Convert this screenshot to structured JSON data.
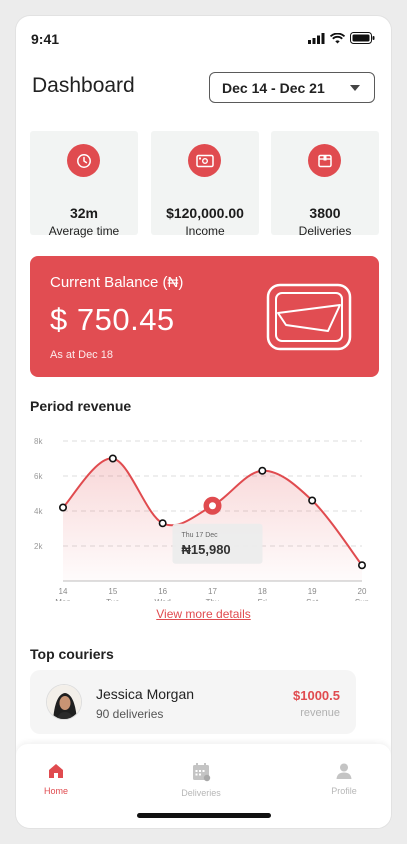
{
  "status_bar": {
    "time": "9:41"
  },
  "header": {
    "title": "Dashboard",
    "date_range": "Dec 14 - Dec 21"
  },
  "stats": [
    {
      "icon": "clock-icon",
      "value": "32m",
      "label": "Average time"
    },
    {
      "icon": "cash-icon",
      "value": "$120,000.00",
      "label": "Income"
    },
    {
      "icon": "package-icon",
      "value": "3800",
      "label": "Deliveries"
    }
  ],
  "balance": {
    "title": "Current Balance (₦)",
    "amount": "$ 750.45",
    "date": "As at Dec 18",
    "icon": "wallet-icon"
  },
  "period_revenue": {
    "title": "Period revenue",
    "link": "View more details"
  },
  "chart_data": {
    "type": "area",
    "title": "Period revenue",
    "y_ticks": [
      "8k",
      "6k",
      "4k",
      "2k"
    ],
    "ylim": [
      0,
      8000
    ],
    "categories": [
      {
        "day": "14",
        "weekday": "Mon"
      },
      {
        "day": "15",
        "weekday": "Tue"
      },
      {
        "day": "16",
        "weekday": "Wed"
      },
      {
        "day": "17",
        "weekday": "Thu"
      },
      {
        "day": "18",
        "weekday": "Fri"
      },
      {
        "day": "19",
        "weekday": "Sat"
      },
      {
        "day": "20",
        "weekday": "Sun"
      }
    ],
    "series": [
      {
        "x": [
          14,
          15,
          16,
          17,
          18,
          19,
          20
        ],
        "values": [
          4200,
          7000,
          3300,
          4300,
          6300,
          4600,
          900
        ]
      }
    ],
    "highlight": {
      "x": 17,
      "label": "Thu 17 Dec",
      "value": "₦15,980"
    },
    "grid": true,
    "accent": "#e04b4f"
  },
  "top_couriers": {
    "title": "Top couriers",
    "items": [
      {
        "name": "Jessica Morgan",
        "deliveries": "90 deliveries",
        "amount": "$1000.5",
        "amount_label": "revenue"
      }
    ]
  },
  "nav": {
    "items": [
      {
        "label": "Home",
        "icon": "home-icon",
        "active": true
      },
      {
        "label": "Deliveries",
        "icon": "calendar-icon",
        "active": false
      },
      {
        "label": "Profile",
        "icon": "user-icon",
        "active": false
      }
    ]
  }
}
